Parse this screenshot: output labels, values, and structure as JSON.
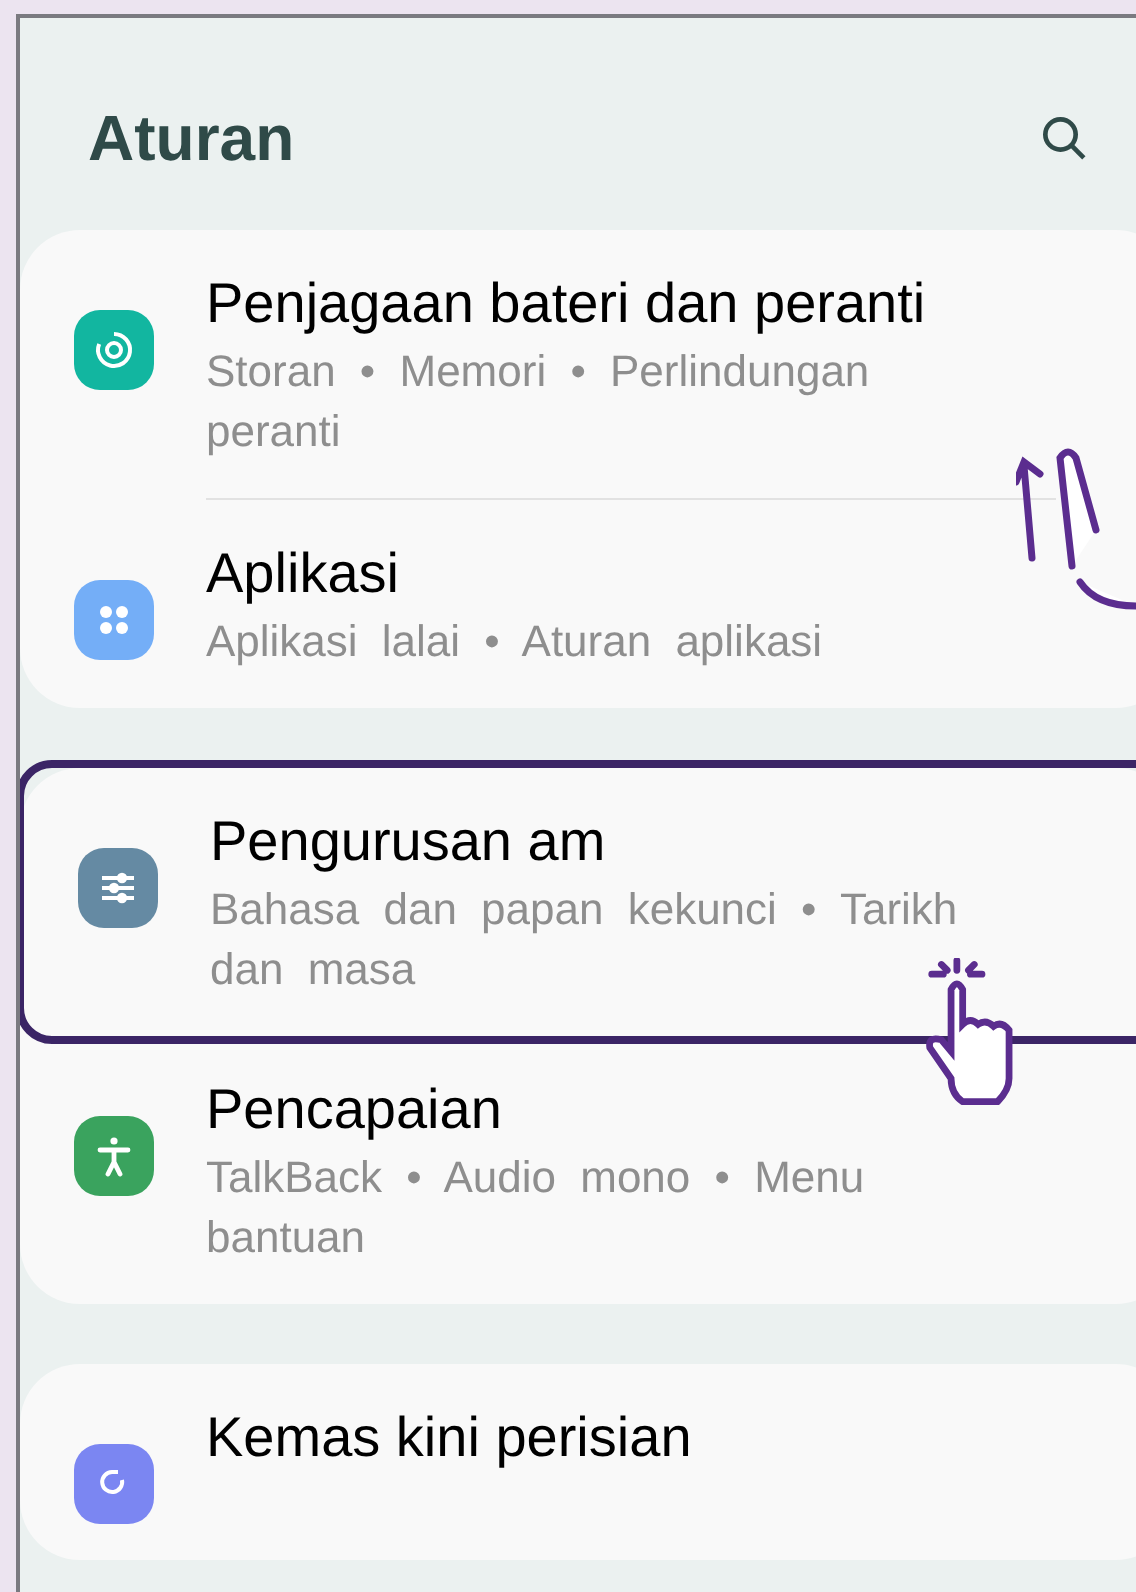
{
  "header": {
    "title": "Aturan"
  },
  "groups": [
    {
      "items": [
        {
          "title": "Penjagaan bateri dan peranti",
          "subtitle": "Storan • Memori • Perlindungan peranti",
          "color": "#12b6a0",
          "highlighted": false
        },
        {
          "title": "Aplikasi",
          "subtitle": "Aplikasi lalai • Aturan aplikasi",
          "color": "#74aef7",
          "highlighted": false
        }
      ]
    },
    {
      "items": [
        {
          "title": "Pengurusan am",
          "subtitle": "Bahasa dan papan kekunci • Tarikh dan masa",
          "color": "#658aa3",
          "highlighted": true
        },
        {
          "title": "Pencapaian",
          "subtitle": "TalkBack • Audio mono • Menu bantuan",
          "color": "#3aa35e",
          "highlighted": false
        }
      ]
    },
    {
      "items": [
        {
          "title": "Kemas kini perisian",
          "color": "#7b86f2",
          "highlighted": false
        }
      ]
    }
  ]
}
